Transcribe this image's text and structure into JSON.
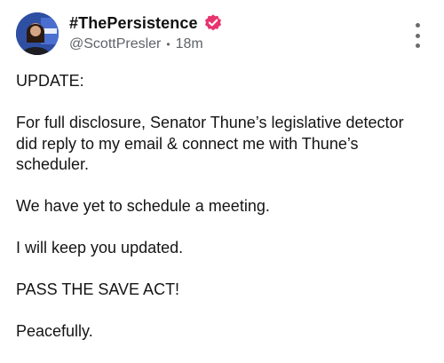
{
  "post": {
    "author": {
      "display_name": "#ThePersistence",
      "handle": "@ScottPresler",
      "time_ago": "18m",
      "separator": "•",
      "verified_icon": "verified-badge-icon",
      "verified_color": "#e8336f"
    },
    "menu_icon": "more-vertical-icon",
    "paragraphs": [
      "UPDATE:",
      "For full disclosure, Senator Thune’s legislative detector did reply to my email & connect me with Thune’s scheduler.",
      "We have yet to schedule a meeting.",
      "I will keep you updated.",
      "PASS THE SAVE ACT!",
      "Peacefully."
    ]
  }
}
